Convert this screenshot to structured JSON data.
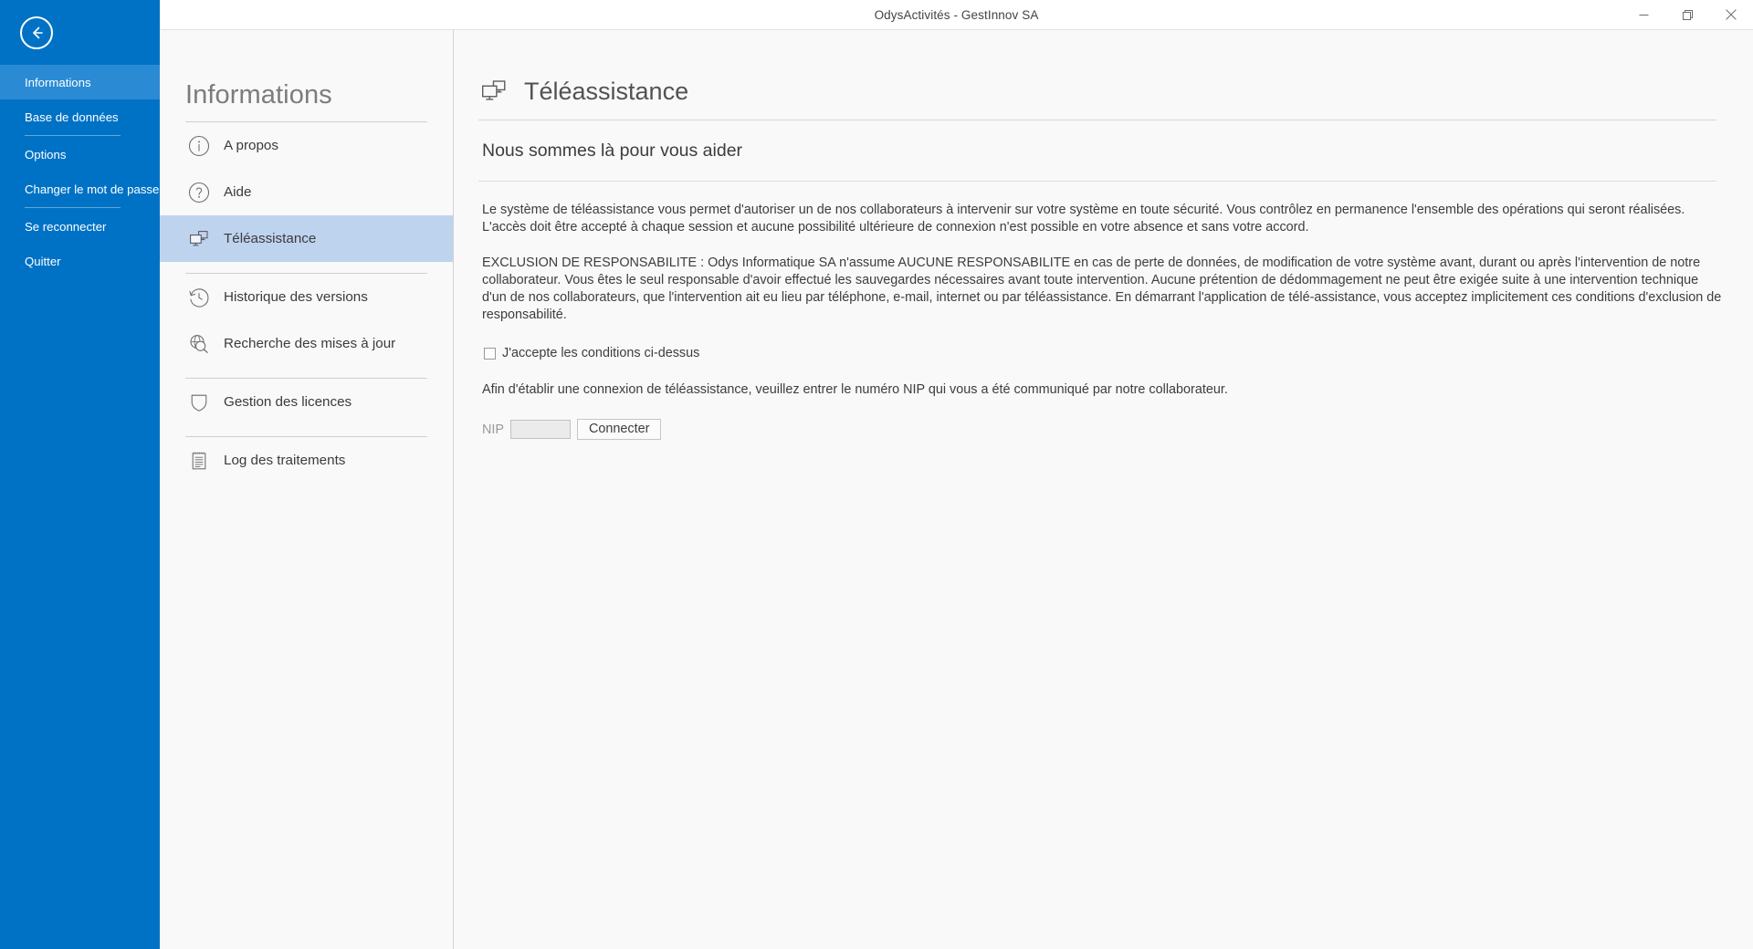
{
  "window": {
    "title": "OdysActivités - GestInnov SA",
    "controls": [
      {
        "name": "minimize",
        "glyph": "minimize-icon"
      },
      {
        "name": "maximize",
        "glyph": "maximize-icon"
      },
      {
        "name": "close",
        "glyph": "close-icon"
      }
    ]
  },
  "colors": {
    "sidebar_blue": "#0072c6",
    "sidebar_active": "#2a8ad4",
    "selection_blue": "#bed3ee",
    "panel_bg": "#f9f9f9",
    "text": "#3d3d41",
    "muted": "#7c7c7f"
  },
  "sidebar": {
    "back_icon": "back-arrow-icon",
    "items": [
      {
        "label": "Informations",
        "active": true,
        "separator_after": false
      },
      {
        "label": "Base de données",
        "active": false,
        "separator_after": true
      },
      {
        "label": "Options",
        "active": false,
        "separator_after": false
      },
      {
        "label": "Changer le mot de passe",
        "active": false,
        "separator_after": true
      },
      {
        "label": "Se reconnecter",
        "active": false,
        "separator_after": false
      },
      {
        "label": "Quitter",
        "active": false,
        "separator_after": false
      }
    ]
  },
  "midpanel": {
    "title": "Informations",
    "items": [
      {
        "label": "A propos",
        "icon": "info-circle-icon",
        "selected": false,
        "separator_after": false
      },
      {
        "label": "Aide",
        "icon": "question-circle-icon",
        "selected": false,
        "separator_after": false
      },
      {
        "label": "Téléassistance",
        "icon": "remote-assistance-icon",
        "selected": true,
        "separator_after": true
      },
      {
        "label": "Historique des versions",
        "icon": "history-clock-icon",
        "selected": false,
        "separator_after": false
      },
      {
        "label": "Recherche des mises à jour",
        "icon": "globe-search-icon",
        "selected": false,
        "separator_after": true
      },
      {
        "label": "Gestion des licences",
        "icon": "shield-icon",
        "selected": false,
        "separator_after": true
      },
      {
        "label": "Log des traitements",
        "icon": "log-document-icon",
        "selected": false,
        "separator_after": false
      }
    ]
  },
  "main": {
    "page_title": "Téléassistance",
    "page_title_icon": "remote-assistance-icon",
    "subtitle": "Nous sommes là pour vous aider",
    "paragraph1": "Le système de téléassistance vous permet d'autoriser un de nos collaborateurs à intervenir sur votre système en toute sécurité. Vous contrôlez en permanence l'ensemble des opérations qui seront réalisées. L'accès doit être accepté à chaque session et aucune possibilité ultérieure de connexion n'est possible en votre absence et sans votre accord.",
    "paragraph2": "EXCLUSION DE RESPONSABILITE : Odys Informatique SA n'assume AUCUNE RESPONSABILITE en cas de perte de données, de modification de votre système avant, durant ou après l'intervention de notre collaborateur. Vous êtes le seul responsable d'avoir effectué les sauvegardes nécessaires avant toute intervention. Aucune prétention de dédommagement ne peut être exigée suite à une intervention technique d'un de nos collaborateurs, que l'intervention ait eu lieu par téléphone, e-mail, internet ou par téléassistance. En démarrant l'application de télé-assistance, vous acceptez implicitement ces conditions d'exclusion de responsabilité.",
    "accept_checkbox": {
      "label": "J'accepte les conditions ci-dessus",
      "checked": false
    },
    "nip_instruction": "Afin d'établir une connexion de téléassistance, veuillez entrer le numéro NIP qui vous a été communiqué par notre collaborateur.",
    "nip_label": "NIP",
    "nip_value": "",
    "nip_placeholder": "",
    "connect_button": "Connecter"
  }
}
